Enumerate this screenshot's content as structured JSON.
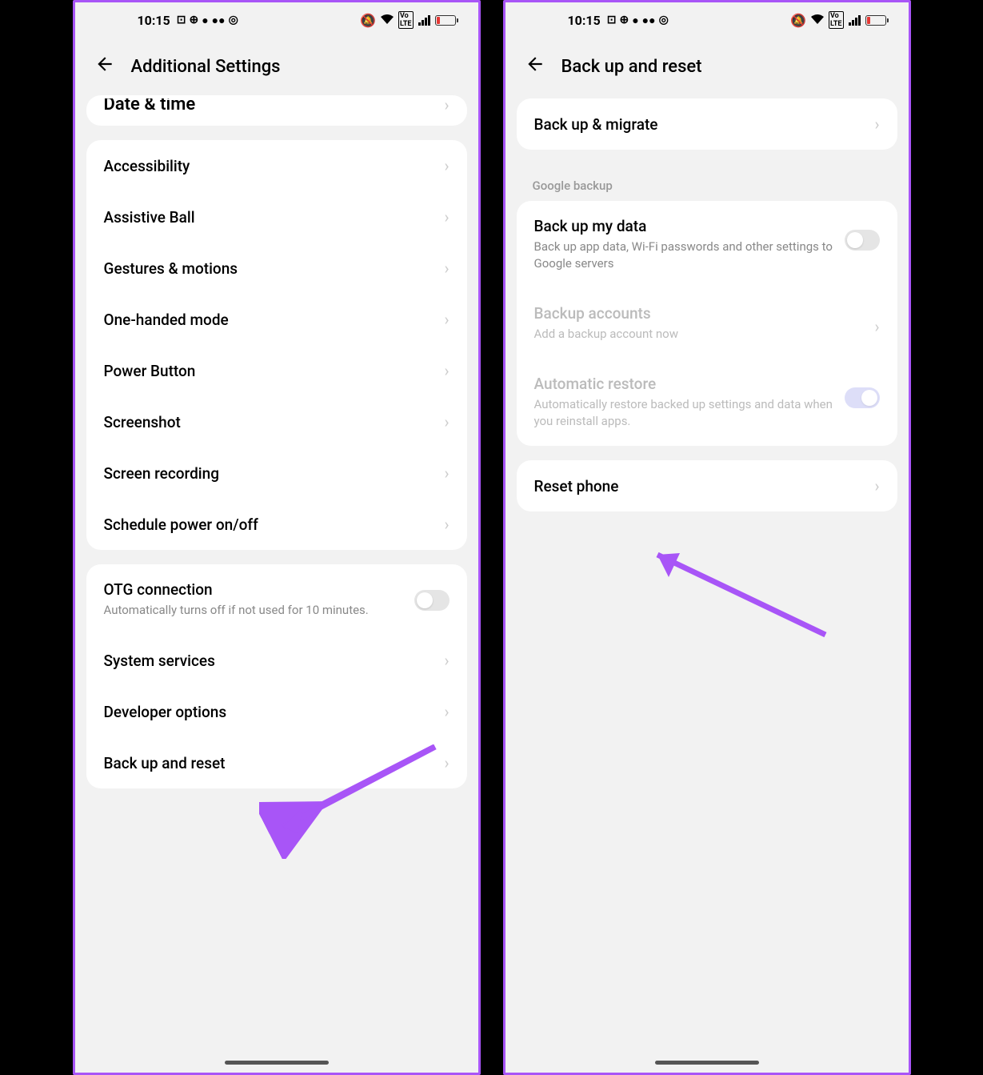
{
  "status": {
    "time": "10:15"
  },
  "left": {
    "title": "Additional Settings",
    "clipped_item": "Date & time",
    "group1": [
      {
        "label": "Accessibility"
      },
      {
        "label": "Assistive Ball"
      },
      {
        "label": "Gestures & motions"
      },
      {
        "label": "One-handed mode"
      },
      {
        "label": "Power Button"
      },
      {
        "label": "Screenshot"
      },
      {
        "label": "Screen recording"
      },
      {
        "label": "Schedule power on/off"
      }
    ],
    "otg": {
      "title": "OTG connection",
      "sub": "Automatically turns off if not used for 10 minutes."
    },
    "group2": [
      {
        "label": "System services"
      },
      {
        "label": "Developer options"
      },
      {
        "label": "Back up and reset"
      }
    ]
  },
  "right": {
    "title": "Back up and reset",
    "backup_migrate": "Back up & migrate",
    "section": "Google backup",
    "backup_my_data": {
      "title": "Back up my data",
      "sub": "Back up app data, Wi-Fi passwords and other settings to Google servers"
    },
    "backup_accounts": {
      "title": "Backup accounts",
      "sub": "Add a backup account now"
    },
    "auto_restore": {
      "title": "Automatic restore",
      "sub": "Automatically restore backed up settings and data when you reinstall apps."
    },
    "reset_phone": "Reset phone"
  }
}
